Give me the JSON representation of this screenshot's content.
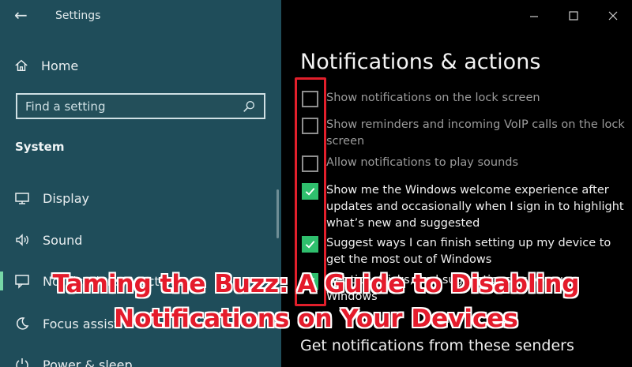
{
  "window": {
    "title": "Settings"
  },
  "sidebar": {
    "home_label": "Home",
    "search": {
      "placeholder": "Find a setting"
    },
    "section_title": "System",
    "items": [
      {
        "label": "Display",
        "icon": "display-icon"
      },
      {
        "label": "Sound",
        "icon": "sound-icon"
      },
      {
        "label": "Notifications & actions",
        "icon": "notifications-icon",
        "active": true
      },
      {
        "label": "Focus assist",
        "icon": "focus-assist-icon"
      },
      {
        "label": "Power & sleep",
        "icon": "power-icon"
      }
    ]
  },
  "main": {
    "title": "Notifications & actions",
    "options": [
      {
        "label": "Show notifications on the lock screen",
        "checked": false
      },
      {
        "label": "Show reminders and incoming VoIP calls on the lock screen",
        "checked": false
      },
      {
        "label": "Allow notifications to play sounds",
        "checked": false
      },
      {
        "label": "Show me the Windows welcome experience after updates and occasionally when I sign in to highlight what’s new and suggested",
        "checked": true
      },
      {
        "label": "Suggest ways I can finish setting up my device to get the most out of Windows",
        "checked": true
      },
      {
        "label": "Get tips, tricks, and suggestions as you use Windows",
        "checked": true
      }
    ],
    "senders_heading": "Get notifications from these senders"
  },
  "banner": {
    "line1": "Taming the Buzz: A Guide to Disabling",
    "line2": "Notifications on Your Devices"
  },
  "colors": {
    "sidebar_bg": "#1f4d5a",
    "accent_green": "#2fbf6d",
    "highlight_red": "#e21f2b"
  }
}
